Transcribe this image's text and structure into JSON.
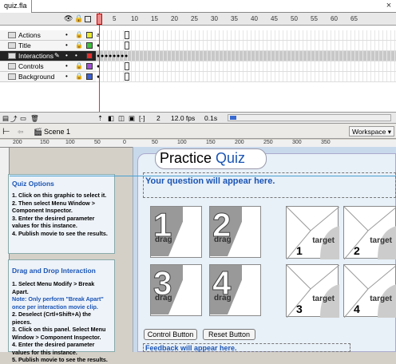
{
  "file_tab": {
    "label": "quiz.fla"
  },
  "timeline": {
    "ruler": [
      "1",
      "5",
      "10",
      "15",
      "20",
      "25",
      "30",
      "35",
      "40",
      "45",
      "50",
      "55",
      "60",
      "65"
    ],
    "layers": [
      {
        "name": "Actions",
        "color": "#e8e830",
        "selected": false
      },
      {
        "name": "Title",
        "color": "#40c040",
        "selected": false
      },
      {
        "name": "Interactions",
        "color": "#e03030",
        "selected": true
      },
      {
        "name": "Controls",
        "color": "#a050d0",
        "selected": false
      },
      {
        "name": "Background",
        "color": "#4060d0",
        "selected": false
      }
    ],
    "footer": {
      "frame": "2",
      "fps": "12.0 fps",
      "time": "0.1s"
    }
  },
  "editbar": {
    "scene": "Scene 1",
    "workspace": "Workspace ▾"
  },
  "hruler": [
    "200",
    "150",
    "100",
    "50",
    "0",
    "50",
    "100",
    "150",
    "200",
    "250",
    "300",
    "350"
  ],
  "quiz_options": {
    "title": "Quiz Options",
    "steps": [
      "1. Click on this graphic to select it.",
      "2. Then select Menu Window > Component Inspector.",
      "3. Enter the desired parameter values for this instance.",
      "4. Publish movie to see the results."
    ]
  },
  "dnd": {
    "title": "Drag and Drop Interaction",
    "step1": "1. Select Menu Modify > Break Apart.",
    "note": "Note: Only perform \"Break Apart\" once per interaction movie clip.",
    "steps": [
      "2. Deselect (Crtl+Shift+A) the pieces.",
      "3. Click on this panel. Select Menu Window > Component Inspector.",
      "4. Enter the desired parameter values for this instance.",
      "5. Publish movie to see the results."
    ]
  },
  "quiz": {
    "title_a": "Practice ",
    "title_b": "Quiz",
    "question": "Your question will appear here.",
    "drag_label": "drag",
    "target_label": "target",
    "drags": [
      "1",
      "2",
      "3",
      "4"
    ],
    "targets": [
      "1",
      "2",
      "3",
      "4"
    ],
    "control_button": "Control Button",
    "reset_button": "Reset Button",
    "feedback": "Feedback will appear here."
  }
}
